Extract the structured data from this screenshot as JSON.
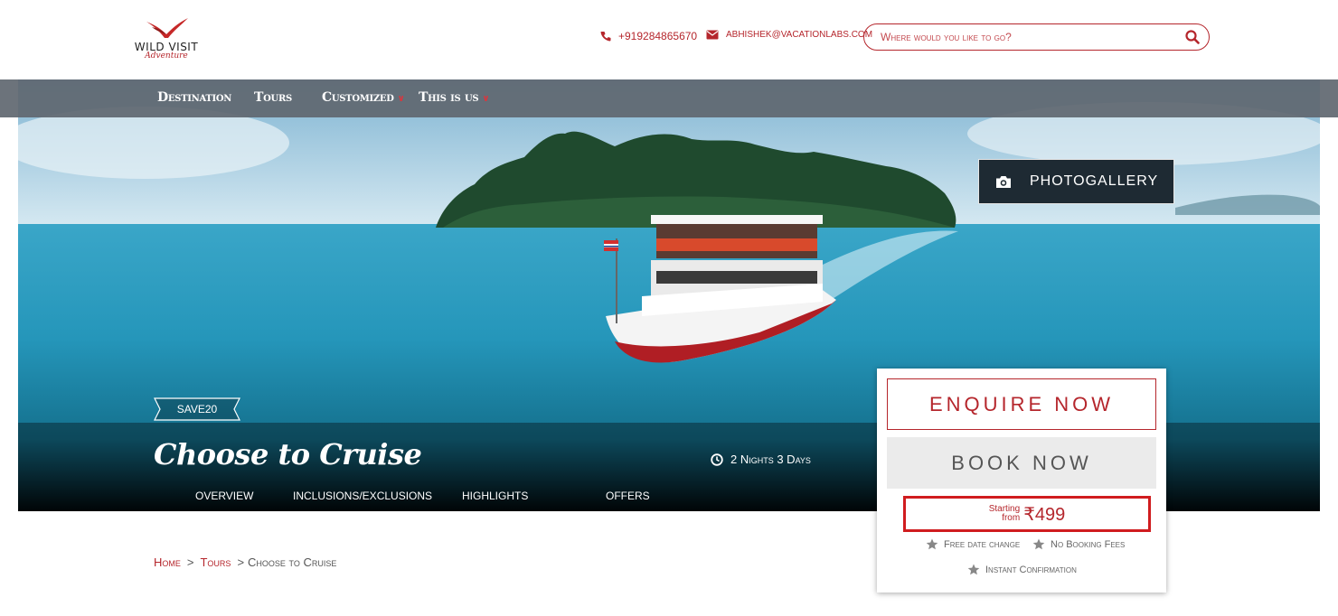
{
  "brand": {
    "name": "WILD VISIT",
    "tagline": "Adventure",
    "accent": "#b5262c"
  },
  "header": {
    "phone": "+919284865670",
    "email": "abhishek@vacationlabs.com",
    "search": {
      "placeholder": "Where would you like to go?"
    }
  },
  "nav": {
    "items": [
      {
        "label": "Destination",
        "has_dropdown": false
      },
      {
        "label": "Tours",
        "has_dropdown": false
      },
      {
        "label": "Customized",
        "has_dropdown": true
      },
      {
        "label": "This is us",
        "has_dropdown": true
      }
    ]
  },
  "hero": {
    "photogallery_label": "PHOTOGALLERY",
    "coupon": "SAVE20",
    "title": "Choose to Cruise",
    "duration": "2 Nights 3 Days",
    "tabs": [
      "OVERVIEW",
      "INCLUSIONS/EXCLUSIONS",
      "HIGHLIGHTS",
      "OFFERS"
    ]
  },
  "booking": {
    "enquire_label": "ENQUIRE NOW",
    "book_label": "BOOK NOW",
    "starting_line1": "Starting",
    "starting_line2": "from",
    "price": "₹499",
    "perks": [
      "Free date change",
      "No Booking Fees",
      "Instant Confirmation"
    ]
  },
  "breadcrumb": {
    "home": "Home",
    "tours": "Tours",
    "current": "Choose to Cruise",
    "separator": ">"
  }
}
